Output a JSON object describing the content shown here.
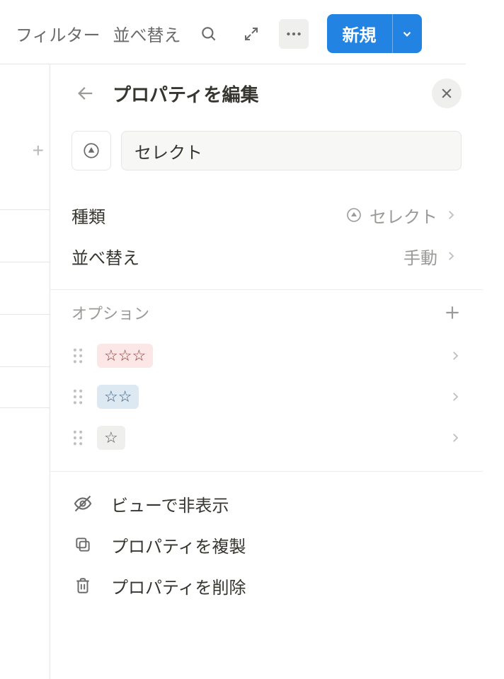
{
  "toolbar": {
    "filter": "フィルター",
    "sort": "並べ替え",
    "new": "新規"
  },
  "panel": {
    "title": "プロパティを編集",
    "name_value": "セレクト",
    "rows": {
      "type": {
        "label": "種類",
        "value": "セレクト"
      },
      "sort": {
        "label": "並べ替え",
        "value": "手動"
      }
    },
    "options_header": "オプション",
    "options": [
      {
        "color": "red",
        "stars": "☆☆☆"
      },
      {
        "color": "blue",
        "stars": "☆☆"
      },
      {
        "color": "grey",
        "stars": "☆"
      }
    ],
    "actions": {
      "hide": "ビューで非表示",
      "duplicate": "プロパティを複製",
      "delete": "プロパティを削除"
    }
  }
}
